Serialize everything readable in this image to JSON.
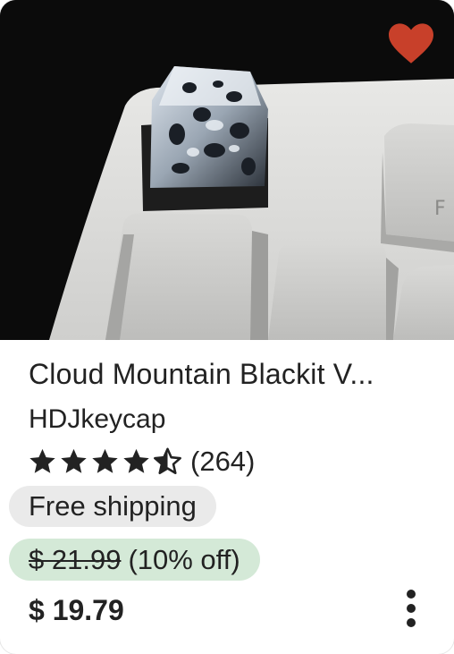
{
  "listing": {
    "title": "Cloud Mountain Blackit V...",
    "shop": "HDJkeycap",
    "rating": 4.5,
    "review_count": "(264)",
    "shipping_badge": "Free shipping",
    "original_price": "$ 21.99",
    "discount": "(10% off)",
    "price": "$ 19.79",
    "favorited": true
  },
  "icons": {
    "favorite": "heart-icon",
    "more": "more-options-icon",
    "star": "star-icon"
  },
  "colors": {
    "heart": "#c8402a",
    "sale_pill": "#d4e9d7",
    "shipping_pill": "#eaeaea",
    "text": "#222222"
  }
}
